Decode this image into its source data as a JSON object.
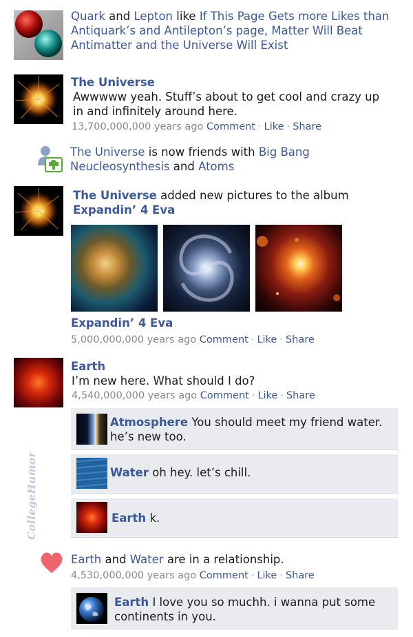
{
  "post1": {
    "actor1": "Quark",
    "and": "and",
    "actor2": "Lepton",
    "verb": "like",
    "page_link": "If This Page Gets more Likes than Antiquark’s and Antilepton’s page, Matter Will Beat Antimatter and the Universe Will Exist"
  },
  "post2": {
    "author": "The Universe",
    "body": "Awwwww yeah. Stuff’s about to get cool and crazy up in and infinitely around here.",
    "time": "13,700,000,000 years ago",
    "comment": "Comment",
    "like": "Like",
    "share": "Share"
  },
  "friends": {
    "actor": "The Universe",
    "text": "is now friends with",
    "friend1": "Big Bang Neucleosynthesis",
    "and": "and",
    "friend2": "Atoms"
  },
  "album_post": {
    "author": "The Universe",
    "text": "added new pictures to the album",
    "album_link": "Expandin’ 4 Eva",
    "album_title": "Expandin’ 4 Eva",
    "time": "5,000,000,000 years ago",
    "comment": "Comment",
    "like": "Like",
    "share": "Share"
  },
  "earth_post": {
    "author": "Earth",
    "body": "I’m new here. What should I do?",
    "time": "4,540,000,000 years ago",
    "comment": "Comment",
    "like": "Like",
    "share": "Share",
    "comments": [
      {
        "author": "Atmosphere",
        "text": "You should meet my friend water. he’s new too."
      },
      {
        "author": "Water",
        "text": "oh hey. let’s chill."
      },
      {
        "author": "Earth",
        "text": "k."
      }
    ]
  },
  "relationship": {
    "actor1": "Earth",
    "and": "and",
    "actor2": "Water",
    "text": "are in a relationship.",
    "time": "4,530,000,000 years ago",
    "comment": "Comment",
    "like": "Like",
    "share": "Share",
    "comment_author": "Earth",
    "comment_text": "I love you so muchh. i wanna put some continents in you."
  },
  "watermark": "CollegeHumor",
  "colors": {
    "link": "#3b5998",
    "comment_bg": "#e9ebee",
    "meta": "#888888"
  }
}
